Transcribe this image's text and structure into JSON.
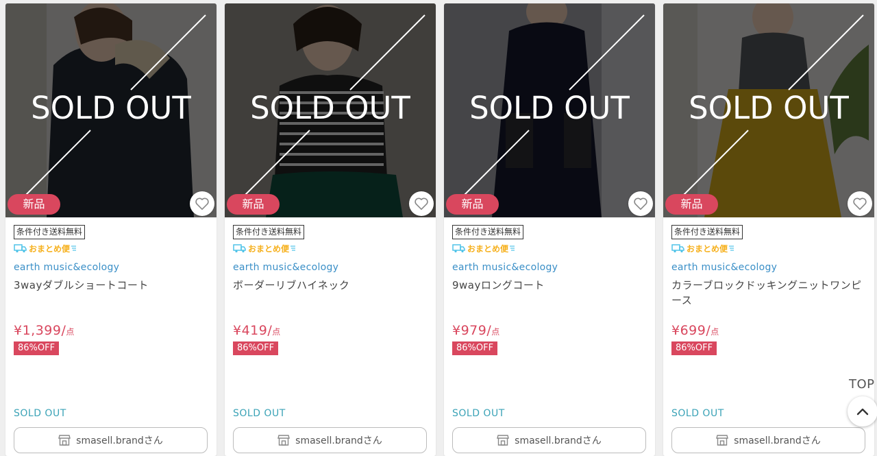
{
  "products": [
    {
      "badge": "新品",
      "sold_out_overlay": "SOLD OUT",
      "shipping": "条件付き送料無料",
      "omatome": "おまとめ便",
      "brand": "earth music&ecology",
      "name": "3wayダブルショートコート",
      "price": "¥1,399/",
      "price_unit": "点",
      "discount": "86%OFF",
      "status": "SOLD OUT",
      "shop": "smasell.brandさん",
      "photo_colors": [
        "#cfcdca",
        "#1f2730"
      ]
    },
    {
      "badge": "新品",
      "sold_out_overlay": "SOLD OUT",
      "shipping": "条件付き送料無料",
      "omatome": "おまとめ便",
      "brand": "earth music&ecology",
      "name": "ボーダーリブハイネック",
      "price": "¥419/",
      "price_unit": "点",
      "discount": "86%OFF",
      "status": "SOLD OUT",
      "shop": "smasell.brandさん",
      "photo_colors": [
        "#8f8a84",
        "#0f4a3b"
      ]
    },
    {
      "badge": "新品",
      "sold_out_overlay": "SOLD OUT",
      "shipping": "条件付き送料無料",
      "omatome": "おまとめ便",
      "brand": "earth music&ecology",
      "name": "9wayロングコート",
      "price": "¥979/",
      "price_unit": "点",
      "discount": "86%OFF",
      "status": "SOLD OUT",
      "shop": "smasell.brandさん",
      "photo_colors": [
        "#9a9aa0",
        "#14182a"
      ]
    },
    {
      "badge": "新品",
      "sold_out_overlay": "SOLD OUT",
      "shipping": "条件付き送料無料",
      "omatome": "おまとめ便",
      "brand": "earth music&ecology",
      "name": "カラーブロックドッキングニットワンピース",
      "price": "¥699/",
      "price_unit": "点",
      "discount": "86%OFF",
      "status": "SOLD OUT",
      "shop": "smasell.brandさん",
      "photo_colors": [
        "#d8d6d2",
        "#c9a21a"
      ]
    }
  ],
  "top": {
    "label": "TOP"
  },
  "colors": {
    "accent": "#d9475e",
    "brand": "#3a8fc7",
    "sold": "#3ba3b7"
  },
  "icons": {
    "favorite": "heart-outline-icon",
    "shop": "storefront-icon",
    "delivery": "truck-icon",
    "scroll_top": "chevron-up-icon"
  }
}
